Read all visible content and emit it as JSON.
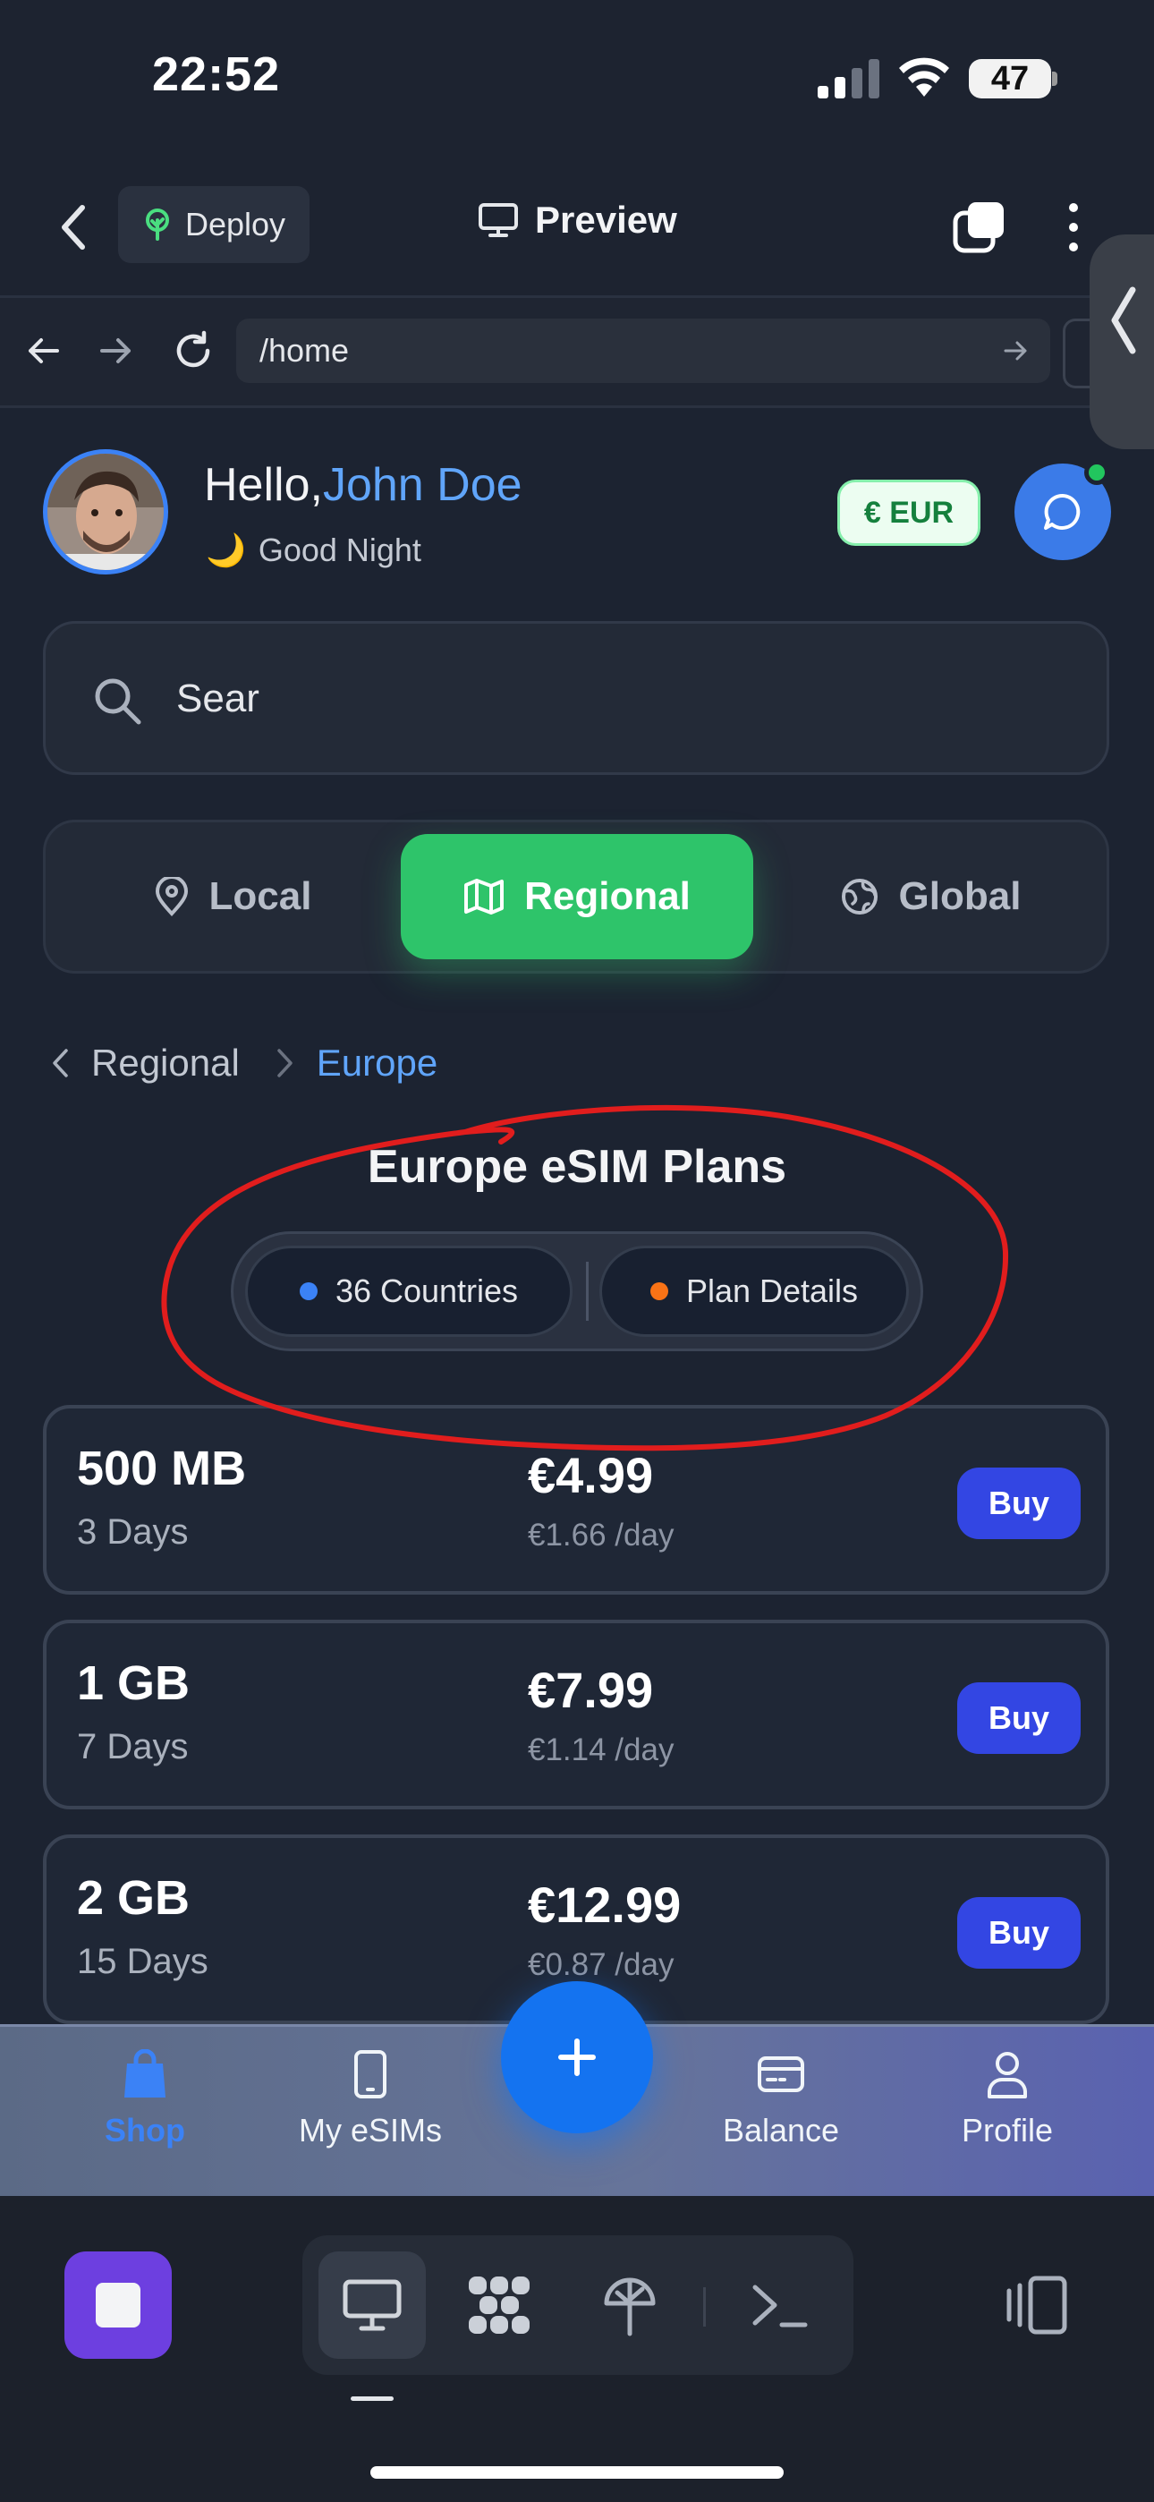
{
  "status_bar": {
    "time": "22:52",
    "battery": "47"
  },
  "topbar": {
    "deploy_label": "Deploy",
    "preview_label": "Preview"
  },
  "browser": {
    "url": "/home"
  },
  "header": {
    "hello": "Hello,",
    "user_name": "John Doe",
    "greeting": "Good Night",
    "greeting_emoji": "🌙",
    "currency": "€ EUR"
  },
  "search": {
    "value": "Sear"
  },
  "segments": {
    "local": "Local",
    "regional": "Regional",
    "global": "Global",
    "selected": "Regional"
  },
  "breadcrumb": {
    "parent": "Regional",
    "current": "Europe"
  },
  "region": {
    "title": "Europe eSIM Plans",
    "countries_label": "36 Countries",
    "details_label": "Plan Details",
    "countries_dot_color": "#3b82f6",
    "details_dot_color": "#f97316"
  },
  "plans": [
    {
      "data": "500 MB",
      "days": "3 Days",
      "price": "€4.99",
      "per_day": "€1.66 /day",
      "buy": "Buy"
    },
    {
      "data": "1 GB",
      "days": "7 Days",
      "price": "€7.99",
      "per_day": "€1.14 /day",
      "buy": "Buy"
    },
    {
      "data": "2 GB",
      "days": "15 Days",
      "price": "€12.99",
      "per_day": "€0.87 /day",
      "buy": "Buy"
    }
  ],
  "bottom_nav": {
    "shop": "Shop",
    "my_esims": "My eSIMs",
    "balance": "Balance",
    "profile": "Profile",
    "active": "Shop"
  },
  "colors": {
    "accent_green": "#2ec46a",
    "accent_blue": "#3b82f6",
    "buy_button": "#3346e3",
    "annotation_red": "#e11d1d"
  }
}
